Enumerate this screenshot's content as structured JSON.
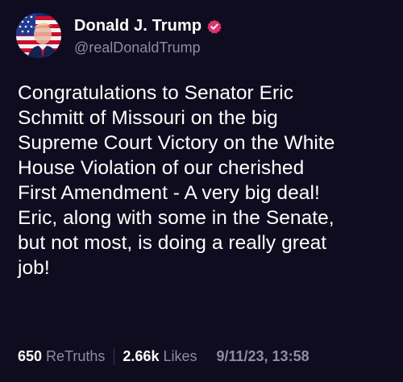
{
  "post": {
    "author": {
      "display_name": "Donald J. Trump",
      "handle": "@realDonaldTrump",
      "verified": true,
      "avatar_icon": "flag-portrait-avatar",
      "verified_icon": "verified-badge-icon"
    },
    "body": "Congratulations to Senator Eric\nSchmitt of Missouri on the big\nSupreme Court Victory on the White\nHouse Violation of our cherished\nFirst Amendment - A very big deal!\nEric, along with some in the Senate,\nbut not most, is doing a really great\njob!",
    "stats": {
      "retruths_count": "650",
      "retruths_label": "ReTruths",
      "likes_count": "2.66k",
      "likes_label": "Likes"
    },
    "timestamp": "9/11/23, 13:58"
  },
  "colors": {
    "background": "#0f0c1f",
    "text_primary": "#ffffff",
    "text_secondary": "#8f8aa5",
    "verified_badge": "#e3326b"
  }
}
